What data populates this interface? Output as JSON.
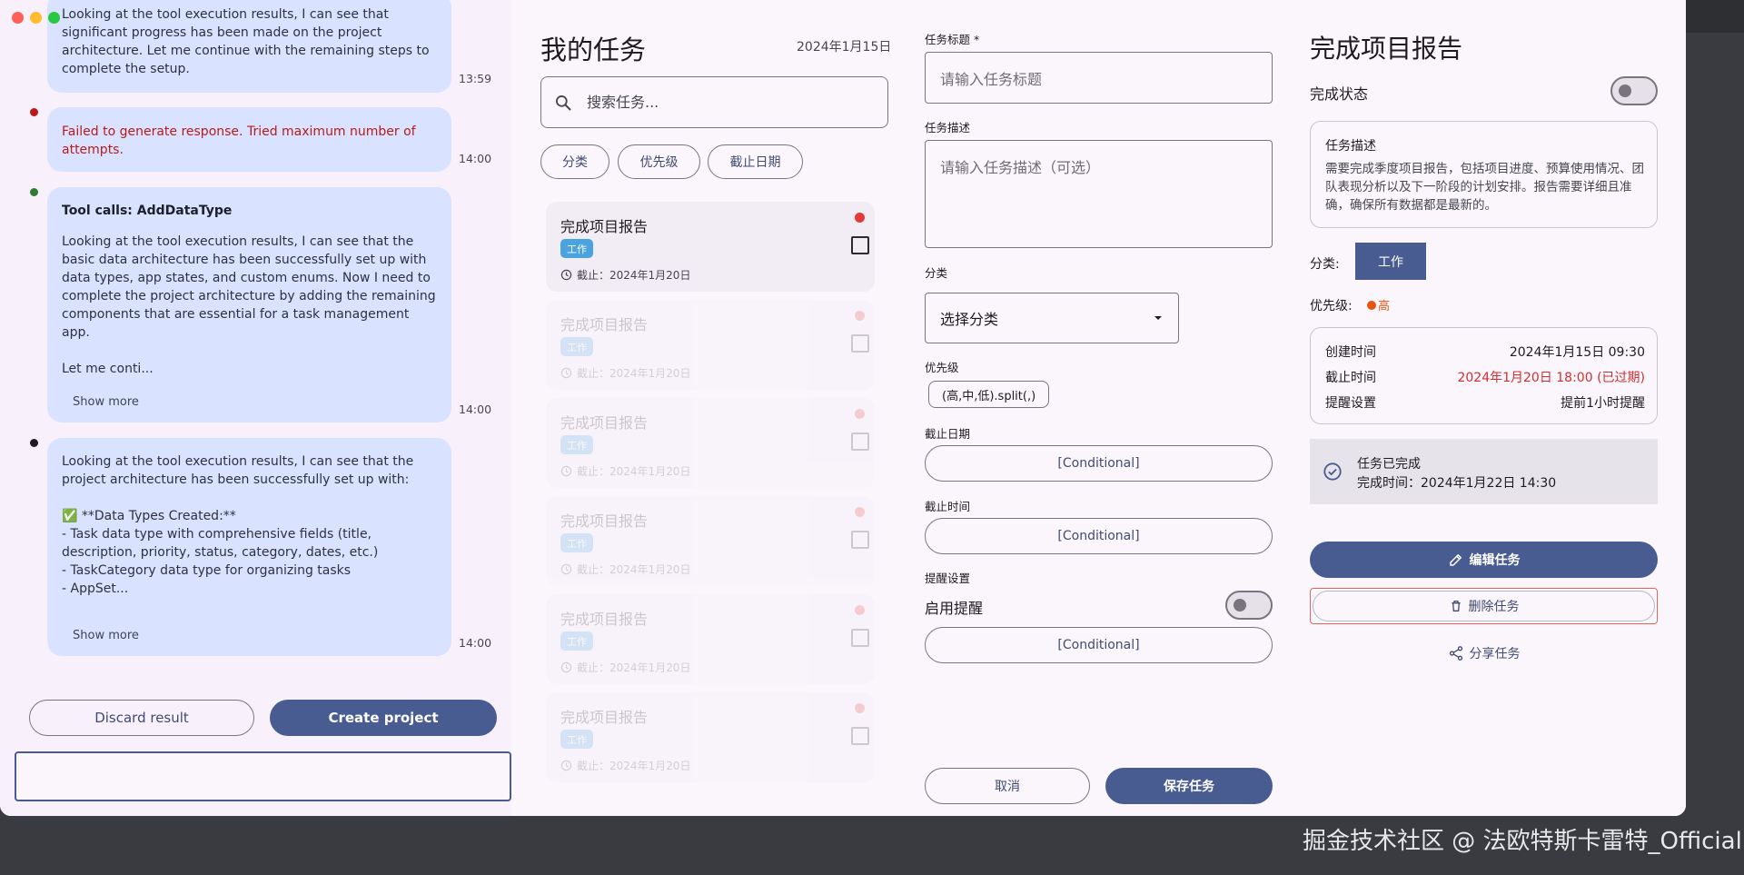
{
  "chat": {
    "messages": [
      {
        "text": "Looking at the tool execution results, I can see that significant progress has been made on the project architecture. Let me continue with the remaining steps to complete the setup.",
        "time": "13:59",
        "status_color": "#ba1a1a"
      },
      {
        "text": "Failed to generate response. Tried maximum number of attempts.",
        "time": "14:00",
        "status_color": "#ba1a1a"
      },
      {
        "title": "Tool calls: AddDataType",
        "text": "Looking at the tool execution results, I can see that the basic data architecture has been successfully set up with data types, app states, and custom enums. Now I need to complete the project architecture by adding the remaining components that are essential for a task management app.\n\nLet me conti...",
        "more": "Show more",
        "time": "14:00",
        "status_color": "#2e7d32"
      },
      {
        "text": "Looking at the tool execution results, I can see that the project architecture has been successfully set up with:\n\n✅ **Data Types Created:**\n- Task data type with comprehensive fields (title, description, priority, status, category, dates, etc.)\n- TaskCategory data type for organizing tasks\n- AppSet...",
        "more": "Show more",
        "time": "14:00",
        "status_color": "#1d1b20"
      }
    ],
    "discard_label": "Discard result",
    "create_label": "Create project"
  },
  "tasks": {
    "title": "我的任务",
    "date": "2024年1月15日",
    "search_placeholder": "搜索任务...",
    "filters": [
      "分类",
      "优先级",
      "截止日期"
    ],
    "cards": [
      {
        "title": "完成项目报告",
        "tag": "工作",
        "due": "截止：2024年1月20日"
      },
      {
        "title": "完成项目报告",
        "tag": "工作",
        "due": "截止：2024年1月20日"
      },
      {
        "title": "完成项目报告",
        "tag": "工作",
        "due": "截止：2024年1月20日"
      },
      {
        "title": "完成项目报告",
        "tag": "工作",
        "due": "截止：2024年1月20日"
      },
      {
        "title": "完成项目报告",
        "tag": "工作",
        "due": "截止：2024年1月20日"
      },
      {
        "title": "完成项目报告",
        "tag": "工作",
        "due": "截止：2024年1月20日"
      }
    ]
  },
  "form": {
    "title_label": "任务标题 *",
    "title_placeholder": "请输入任务标题",
    "desc_label": "任务描述",
    "desc_placeholder": "请输入任务描述（可选）",
    "category_label": "分类",
    "category_value": "选择分类",
    "priority_label": "优先级",
    "priority_value": "(高,中,低).split(,)",
    "due_date_label": "截止日期",
    "due_date_value": "[Conditional]",
    "due_time_label": "截止时间",
    "due_time_value": "[Conditional]",
    "reminder_label": "提醒设置",
    "enable_reminder": "启用提醒",
    "reminder_value": "[Conditional]",
    "cancel_label": "取消",
    "save_label": "保存任务"
  },
  "detail": {
    "title": "完成项目报告",
    "status_label": "完成状态",
    "desc_title": "任务描述",
    "desc_text": "需要完成季度项目报告，包括项目进度、预算使用情况、团队表现分析以及下一阶段的计划安排。报告需要详细且准确，确保所有数据都是最新的。",
    "category_label": "分类:",
    "category_value": "工作",
    "priority_label": "优先级:",
    "priority_value": "高",
    "created_label": "创建时间",
    "created_value": "2024年1月15日 09:30",
    "due_label": "截止时间",
    "due_value": "2024年1月20日 18:00 (已过期)",
    "reminder_label": "提醒设置",
    "reminder_value": "提前1小时提醒",
    "done_title": "任务已完成",
    "done_time": "完成时间：2024年1月22日 14:30",
    "edit_label": "编辑任务",
    "delete_label": "删除任务",
    "share_label": "分享任务"
  },
  "watermark": "掘金技术社区 @ 法欧特斯卡雷特_Official",
  "colors": {
    "primary": "#485c91",
    "error": "#ba1a1a",
    "priority_high": "#e8550f",
    "chat_bubble": "#d9e2ff"
  }
}
